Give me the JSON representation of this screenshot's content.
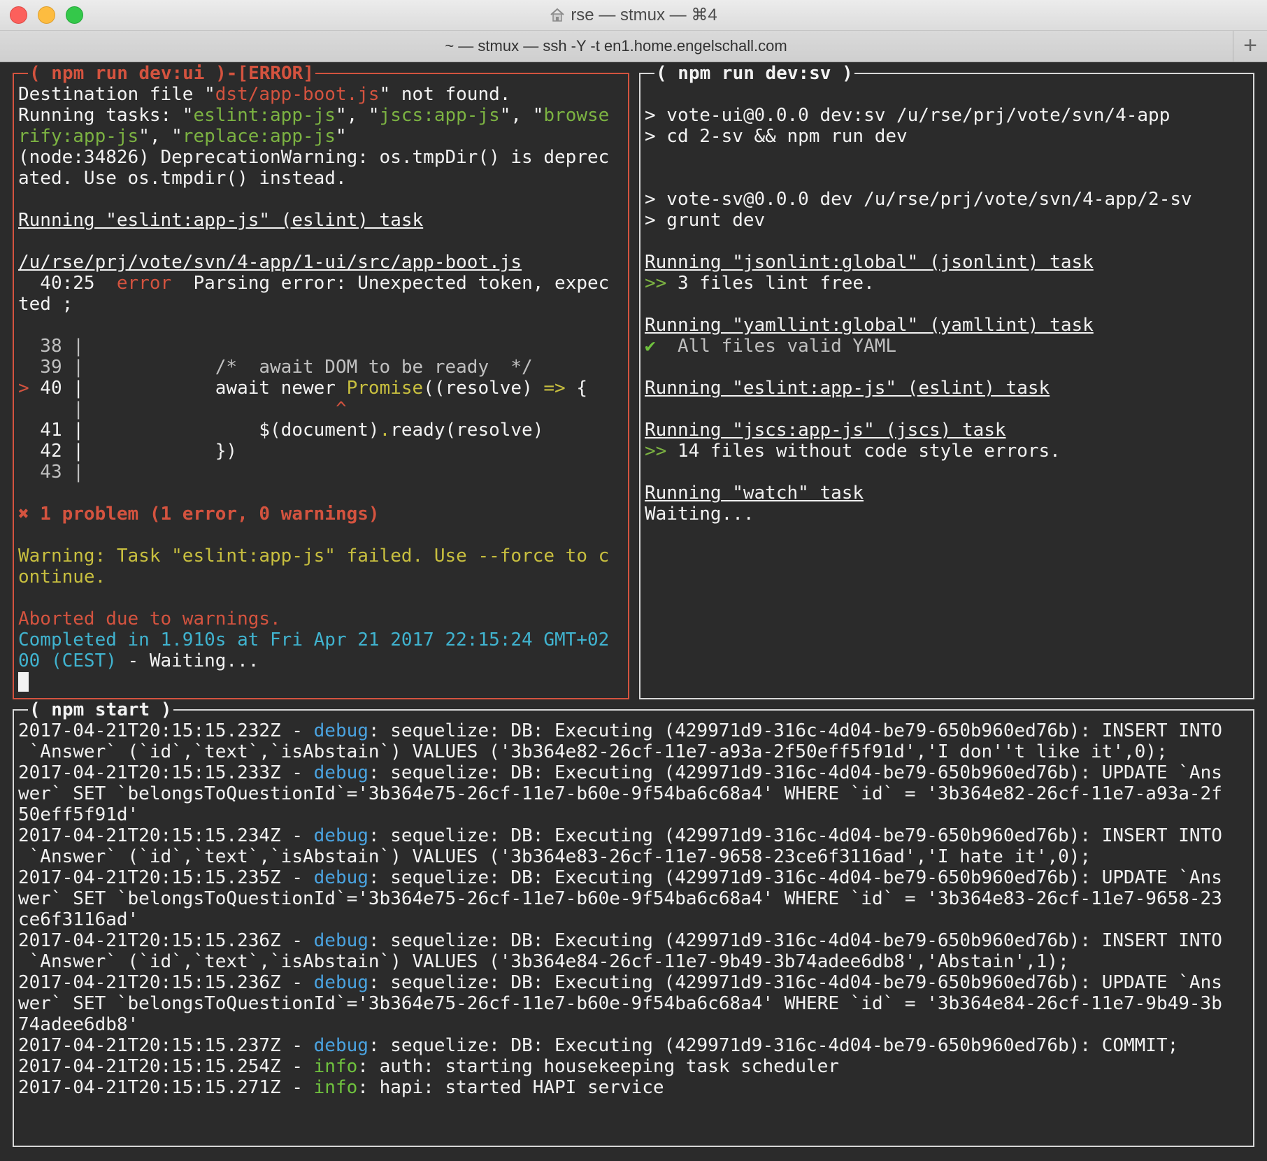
{
  "window": {
    "title": "rse — stmux — ⌘4",
    "tab_title": "~ — stmux — ssh -Y -t en1.home.engelschall.com",
    "new_tab": "+"
  },
  "colors": {
    "error": "#d4533f",
    "green": "#7cb342",
    "yellow": "#c8bf3f",
    "cyan": "#40b3cf",
    "debug_blue": "#4aa3e0",
    "info_green": "#6fc23e",
    "background": "#2b2b2b"
  },
  "panes": {
    "ui": {
      "title": "( npm run dev:ui )-[ERROR]",
      "l1": [
        "Destination file \"",
        "dst/app-boot.js",
        "\" not found."
      ],
      "l2": [
        "Running tasks: \"",
        "eslint:app-js",
        "\", \"",
        "jscs:app-js",
        "\", \"",
        "browse"
      ],
      "l3": [
        "rify:app-js",
        "\", \"",
        "replace:app-js",
        "\""
      ],
      "l4": "(node:34826) DeprecationWarning: os.tmpDir() is deprec",
      "l5": "ated. Use os.tmpdir() instead.",
      "l6": "",
      "l7": "Running \"eslint:app-js\" (eslint) task",
      "l8": "",
      "l9": "/u/rse/prj/vote/svn/4-app/1-ui/src/app-boot.js",
      "l10": [
        "  40:25  ",
        "error",
        "  Parsing error: Unexpected token, expec"
      ],
      "l11": "ted ;",
      "l12": "",
      "l13": "  38 |",
      "l14": [
        "  39 |          ",
        "  /*  await DOM to be ready  */"
      ],
      "l15": [
        ">",
        " 40 |            await newer ",
        "Promise",
        "((resolve) ",
        "=>",
        " {"
      ],
      "l16": [
        "     |                       ",
        "^"
      ],
      "l17": [
        "  41 |                $(document)",
        ".",
        "ready(resolve)"
      ],
      "l18": "  42 |            })",
      "l19": "  43 |",
      "l20": "",
      "l21": "✖ 1 problem (1 error, 0 warnings)",
      "l22": "",
      "l23": "Warning: Task \"eslint:app-js\" failed. Use --force to c",
      "l24": "ontinue.",
      "l25": "",
      "l26": "Aborted due to warnings.",
      "l27": "Completed in 1.910s at Fri Apr 21 2017 22:15:24 GMT+02",
      "l28": [
        "00 (CEST)",
        " - Waiting..."
      ]
    },
    "sv": {
      "title": "( npm run dev:sv )",
      "lines": [
        "",
        "> vote-ui@0.0.0 dev:sv /u/rse/prj/vote/svn/4-app",
        "> cd 2-sv && npm run dev",
        "",
        "",
        "> vote-sv@0.0.0 dev /u/rse/prj/vote/svn/4-app/2-sv",
        "> grunt dev",
        ""
      ],
      "t1": "Running \"jsonlint:global\" (jsonlint) task",
      "t1_out": [
        ">>",
        " 3 files lint free."
      ],
      "t2": "Running \"yamllint:global\" (yamllint) task",
      "t2_out": [
        "✔",
        "  All files valid YAML"
      ],
      "t3": "Running \"eslint:app-js\" (eslint) task",
      "t4": "Running \"jscs:app-js\" (jscs) task",
      "t4_out": [
        ">>",
        " 14 files without code style errors."
      ],
      "t5": "Running \"watch\" task",
      "t5_out": "Waiting..."
    },
    "start": {
      "title": "( npm start )",
      "log": [
        {
          "ts": "2017-04-21T20:15:15.232Z - ",
          "level": "debug",
          "msg": ": sequelize: DB: Executing (429971d9-316c-4d04-be79-650b960ed76b): INSERT INTO",
          "cont": [
            " `Answer` (`id`,`text`,`isAbstain`) VALUES ('3b364e82-26cf-11e7-a93a-2f50eff5f91d','I don''t like it',0);"
          ]
        },
        {
          "ts": "2017-04-21T20:15:15.233Z - ",
          "level": "debug",
          "msg": ": sequelize: DB: Executing (429971d9-316c-4d04-be79-650b960ed76b): UPDATE `Ans",
          "cont": [
            "wer` SET `belongsToQuestionId`='3b364e75-26cf-11e7-b60e-9f54ba6c68a4' WHERE `id` = '3b364e82-26cf-11e7-a93a-2f",
            "50eff5f91d'"
          ]
        },
        {
          "ts": "2017-04-21T20:15:15.234Z - ",
          "level": "debug",
          "msg": ": sequelize: DB: Executing (429971d9-316c-4d04-be79-650b960ed76b): INSERT INTO",
          "cont": [
            " `Answer` (`id`,`text`,`isAbstain`) VALUES ('3b364e83-26cf-11e7-9658-23ce6f3116ad','I hate it',0);"
          ]
        },
        {
          "ts": "2017-04-21T20:15:15.235Z - ",
          "level": "debug",
          "msg": ": sequelize: DB: Executing (429971d9-316c-4d04-be79-650b960ed76b): UPDATE `Ans",
          "cont": [
            "wer` SET `belongsToQuestionId`='3b364e75-26cf-11e7-b60e-9f54ba6c68a4' WHERE `id` = '3b364e83-26cf-11e7-9658-23",
            "ce6f3116ad'"
          ]
        },
        {
          "ts": "2017-04-21T20:15:15.236Z - ",
          "level": "debug",
          "msg": ": sequelize: DB: Executing (429971d9-316c-4d04-be79-650b960ed76b): INSERT INTO",
          "cont": [
            " `Answer` (`id`,`text`,`isAbstain`) VALUES ('3b364e84-26cf-11e7-9b49-3b74adee6db8','Abstain',1);"
          ]
        },
        {
          "ts": "2017-04-21T20:15:15.236Z - ",
          "level": "debug",
          "msg": ": sequelize: DB: Executing (429971d9-316c-4d04-be79-650b960ed76b): UPDATE `Ans",
          "cont": [
            "wer` SET `belongsToQuestionId`='3b364e75-26cf-11e7-b60e-9f54ba6c68a4' WHERE `id` = '3b364e84-26cf-11e7-9b49-3b",
            "74adee6db8'"
          ]
        },
        {
          "ts": "2017-04-21T20:15:15.237Z - ",
          "level": "debug",
          "msg": ": sequelize: DB: Executing (429971d9-316c-4d04-be79-650b960ed76b): COMMIT;",
          "cont": []
        },
        {
          "ts": "2017-04-21T20:15:15.254Z - ",
          "level": "info",
          "msg": ": auth: starting housekeeping task scheduler",
          "cont": []
        },
        {
          "ts": "2017-04-21T20:15:15.271Z - ",
          "level": "info",
          "msg": ": hapi: started HAPI service",
          "cont": []
        }
      ]
    }
  }
}
